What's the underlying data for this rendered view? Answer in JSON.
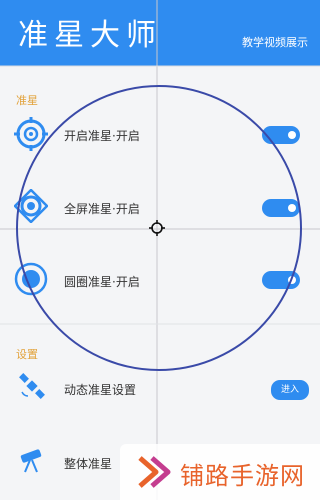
{
  "header": {
    "title": "准星大师",
    "tutorial_label": "教学视频展示"
  },
  "sections": {
    "crosshair_label": "准星",
    "settings_label": "设置"
  },
  "crosshair_items": [
    {
      "label": "开启准星·开启",
      "icon": "target-ring-icon",
      "enabled": true
    },
    {
      "label": "全屏准星·开启",
      "icon": "target-diamond-icon",
      "enabled": true
    },
    {
      "label": "圆圈准星·开启",
      "icon": "target-dot-icon",
      "enabled": true
    }
  ],
  "settings_items": [
    {
      "label": "动态准星设置",
      "icon": "satellite-icon",
      "button": "进入"
    },
    {
      "label": "整体准星",
      "icon": "telescope-icon"
    }
  ],
  "watermark": {
    "text": "铺路手游网",
    "logo": "play-chevron-logo"
  },
  "colors": {
    "header": "#2f8cf0",
    "accent": "#2f8cf0",
    "section_label": "#e2a23b",
    "overlay_circle": "#3a4aa8",
    "watermark": "#e8632b"
  }
}
